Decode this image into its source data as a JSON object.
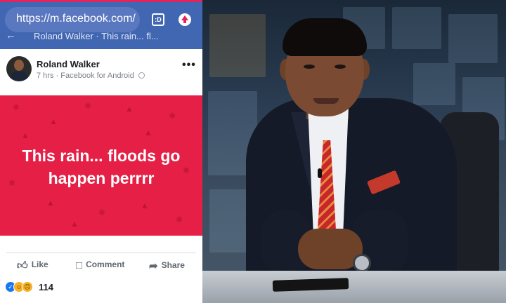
{
  "browser": {
    "url": "https://m.facebook.com/st",
    "tabs_count": ":D"
  },
  "fb_header": {
    "title": "Roland Walker · This rain... fl..."
  },
  "post": {
    "author": "Roland Walker",
    "time": "7 hrs",
    "source": "Facebook for Android",
    "more_label": "•••",
    "text": "This rain... floods go happen perrrr",
    "reactions_count": "114"
  },
  "actions": {
    "like": "Like",
    "comment": "Comment",
    "share": "Share"
  },
  "colors": {
    "facebook_blue": "#4267b2",
    "post_background": "#e51f46",
    "accent_red": "#e0245e"
  },
  "icons": {
    "back": "arrow-left-icon",
    "tabs": "tab-switcher-icon",
    "upload": "upload-arrow-icon",
    "globe": "globe-icon",
    "more": "more-options-icon",
    "like": "thumbs-up-icon",
    "comment": "speech-bubble-icon",
    "share": "share-arrow-icon"
  }
}
